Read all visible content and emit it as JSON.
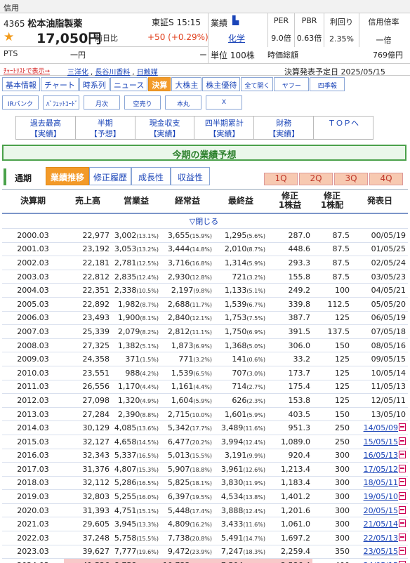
{
  "header": {
    "section": "信用",
    "code": "4365",
    "name": "松本油脂製薬",
    "market": "東証S",
    "time": "15:15",
    "price": "17,050円",
    "change_label": "前日比",
    "change": "+50",
    "change_pct": "(+0.29%)",
    "pts_label": "PTS",
    "pts_value": "一円",
    "pts_dash": "ー",
    "industry_label": "業績",
    "industry": "化学",
    "unit_label": "単位",
    "unit": "100株",
    "per_label": "PER",
    "per": "9.0倍",
    "pbr_label": "PBR",
    "pbr": "0.63倍",
    "yield_label": "利回り",
    "yield": "2.35%",
    "margin_label": "信用倍率",
    "margin": "一倍",
    "cap_label": "時価総額",
    "cap": "769億円"
  },
  "watchlist": {
    "label": "ﾁｬｰﾄﾘｽﾄで表示→",
    "links": [
      "三洋化",
      "長谷川香料",
      "日触媒"
    ],
    "settle": "決算発表予定日 2025/05/15"
  },
  "tabs": [
    "基本情報",
    "チャート",
    "時系列",
    "ニュース",
    "決算",
    "大株主",
    "株主優待",
    "全て開く",
    "ヤフー",
    "四季報"
  ],
  "tabs2": [
    "IRバンク",
    "ﾊﾞﾌｪｯﾄｺｰﾄﾞ",
    "月次",
    "空売り",
    "本丸",
    "X"
  ],
  "nav": [
    [
      "過去最高",
      "【実績】"
    ],
    [
      "半期",
      "【予想】"
    ],
    [
      "現金収支",
      "【実績】"
    ],
    [
      "四半期累計",
      "【実績】"
    ],
    [
      "財務",
      "【実績】"
    ],
    [
      "ＴＯＰへ",
      ""
    ]
  ],
  "banner": "今期の業績予想",
  "subtabs": {
    "main": "通期",
    "tabs": [
      "業績推移",
      "修正履歴",
      "成長性",
      "収益性"
    ],
    "q": [
      "1Q",
      "2Q",
      "3Q",
      "4Q"
    ]
  },
  "table": {
    "headers": [
      "決算期",
      "売上高",
      "営業益",
      "経常益",
      "最終益",
      "修正\n1株益",
      "修正\n1株配",
      "発表日"
    ],
    "hide": "▽閉じる",
    "rows": [
      [
        "2000.03",
        "22,977",
        "3,002",
        "13.1",
        "3,655",
        "15.9",
        "1,295",
        "5.6",
        "287.0",
        "87.5",
        "00/05/19",
        false
      ],
      [
        "2001.03",
        "23,192",
        "3,053",
        "13.2",
        "3,444",
        "14.8",
        "2,010",
        "8.7",
        "448.6",
        "87.5",
        "01/05/25",
        false
      ],
      [
        "2002.03",
        "22,181",
        "2,781",
        "12.5",
        "3,716",
        "16.8",
        "1,314",
        "5.9",
        "293.3",
        "87.5",
        "02/05/24",
        false
      ],
      [
        "2003.03",
        "22,812",
        "2,835",
        "12.4",
        "2,930",
        "12.8",
        "721",
        "3.2",
        "155.8",
        "87.5",
        "03/05/23",
        false
      ],
      [
        "2004.03",
        "22,351",
        "2,338",
        "10.5",
        "2,197",
        "9.8",
        "1,133",
        "5.1",
        "249.2",
        "100",
        "04/05/21",
        false
      ],
      [
        "2005.03",
        "22,892",
        "1,982",
        "8.7",
        "2,688",
        "11.7",
        "1,539",
        "6.7",
        "339.8",
        "112.5",
        "05/05/20",
        false
      ],
      [
        "2006.03",
        "23,493",
        "1,900",
        "8.1",
        "2,840",
        "12.1",
        "1,753",
        "7.5",
        "387.7",
        "125",
        "06/05/19",
        false
      ],
      [
        "2007.03",
        "25,339",
        "2,079",
        "8.2",
        "2,812",
        "11.1",
        "1,750",
        "6.9",
        "391.5",
        "137.5",
        "07/05/18",
        false
      ],
      [
        "2008.03",
        "27,325",
        "1,382",
        "5.1",
        "1,873",
        "6.9",
        "1,368",
        "5.0",
        "306.0",
        "150",
        "08/05/16",
        false
      ],
      [
        "2009.03",
        "24,358",
        "371",
        "1.5",
        "771",
        "3.2",
        "141",
        "0.6",
        "33.2",
        "125",
        "09/05/15",
        false
      ],
      [
        "2010.03",
        "23,551",
        "988",
        "4.2",
        "1,539",
        "6.5",
        "707",
        "3.0",
        "173.7",
        "125",
        "10/05/14",
        false
      ],
      [
        "2011.03",
        "26,556",
        "1,170",
        "4.4",
        "1,161",
        "4.4",
        "714",
        "2.7",
        "175.4",
        "125",
        "11/05/13",
        false
      ],
      [
        "2012.03",
        "27,098",
        "1,320",
        "4.9",
        "1,604",
        "5.9",
        "626",
        "2.3",
        "153.8",
        "125",
        "12/05/11",
        false
      ],
      [
        "2013.03",
        "27,284",
        "2,390",
        "8.8",
        "2,715",
        "10.0",
        "1,601",
        "5.9",
        "403.5",
        "150",
        "13/05/10",
        false
      ],
      [
        "2014.03",
        "30,129",
        "4,085",
        "13.6",
        "5,342",
        "17.7",
        "3,489",
        "11.6",
        "951.3",
        "250",
        "14/05/09",
        true
      ],
      [
        "2015.03",
        "32,127",
        "4,658",
        "14.5",
        "6,477",
        "20.2",
        "3,994",
        "12.4",
        "1,089.0",
        "250",
        "15/05/15",
        true
      ],
      [
        "2016.03",
        "32,343",
        "5,337",
        "16.5",
        "5,013",
        "15.5",
        "3,191",
        "9.9",
        "920.4",
        "300",
        "16/05/13",
        true
      ],
      [
        "2017.03",
        "31,376",
        "4,807",
        "15.3",
        "5,907",
        "18.8",
        "3,961",
        "12.6",
        "1,213.4",
        "300",
        "17/05/12",
        true
      ],
      [
        "2018.03",
        "32,112",
        "5,286",
        "16.5",
        "5,825",
        "18.1",
        "3,830",
        "11.9",
        "1,183.4",
        "300",
        "18/05/11",
        true
      ],
      [
        "2019.03",
        "32,803",
        "5,255",
        "16.0",
        "6,397",
        "19.5",
        "4,534",
        "13.8",
        "1,401.2",
        "300",
        "19/05/10",
        true
      ],
      [
        "2020.03",
        "31,393",
        "4,751",
        "15.1",
        "5,448",
        "17.4",
        "3,888",
        "12.4",
        "1,201.6",
        "300",
        "20/05/15",
        true
      ],
      [
        "2021.03",
        "29,605",
        "3,945",
        "13.3",
        "4,809",
        "16.2",
        "3,433",
        "11.6",
        "1,061.0",
        "300",
        "21/05/14",
        true
      ],
      [
        "2022.03",
        "37,248",
        "5,758",
        "15.5",
        "7,738",
        "20.8",
        "5,491",
        "14.7",
        "1,697.2",
        "300",
        "22/05/13",
        true
      ],
      [
        "2023.03",
        "39,627",
        "7,777",
        "19.6",
        "9,472",
        "23.9",
        "7,247",
        "18.3",
        "2,259.4",
        "350",
        "23/05/15",
        true
      ],
      [
        "2024.03",
        "41,526",
        "8,758",
        "21.1",
        "10,733",
        "25.8",
        "7,504",
        "18.1",
        "2,586.4",
        "400",
        "24/05/15",
        true
      ],
      [
        "予 2025.03",
        "41,300",
        "8,500",
        "20.6",
        "8,000",
        "19.4",
        "5,500",
        "13.3",
        "1,895.7",
        "400",
        "24/08/09",
        true
      ]
    ]
  }
}
